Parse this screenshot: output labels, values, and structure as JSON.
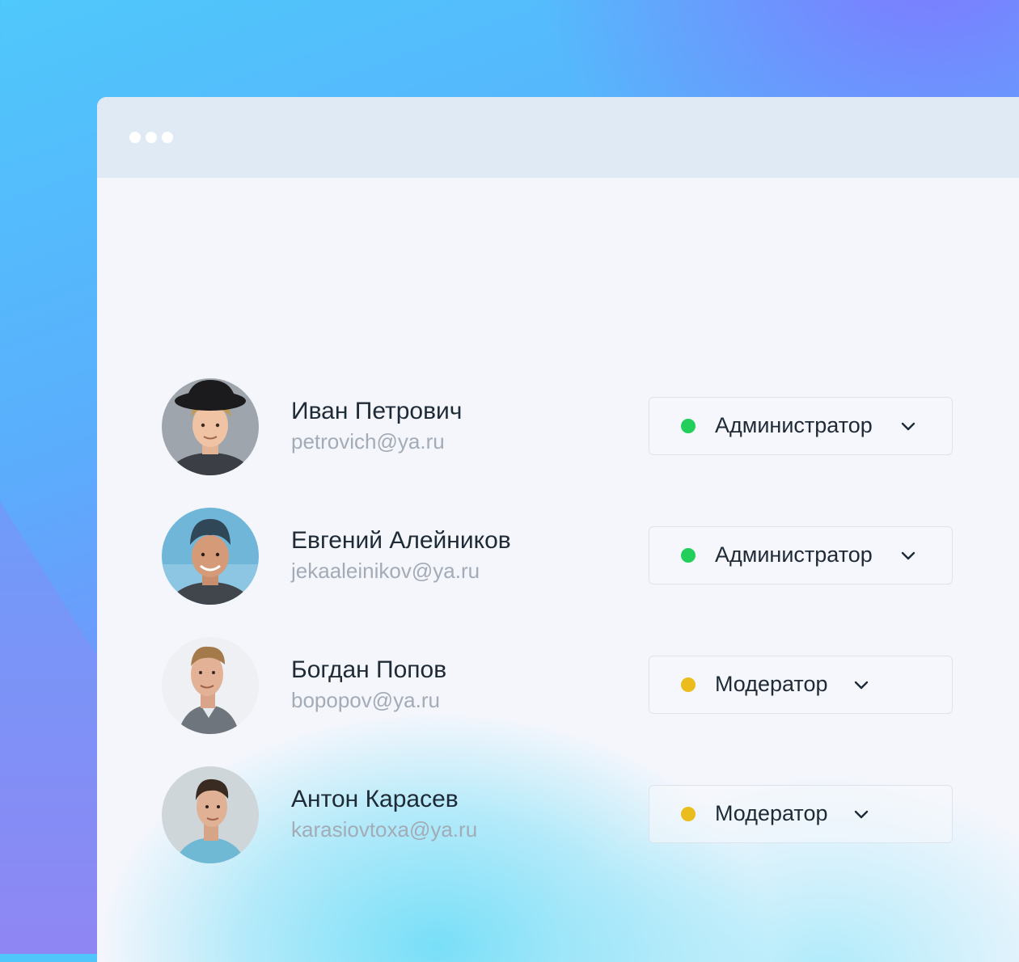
{
  "colors": {
    "admin_status": "#22cf5a",
    "moderator_status": "#eabd1c",
    "name_text": "#1e2a36",
    "email_text": "#a3abb6"
  },
  "users": [
    {
      "name": "Иван Петрович",
      "email": "petrovich@ya.ru",
      "role": "Администратор",
      "status": "green",
      "avatar_icon": "user-photo-avatar"
    },
    {
      "name": "Евгений Алейников",
      "email": "jekaaleinikov@ya.ru",
      "role": "Администратор",
      "status": "green",
      "avatar_icon": "user-photo-avatar"
    },
    {
      "name": "Богдан Попов",
      "email": "bopopov@ya.ru",
      "role": "Модератор",
      "status": "yellow",
      "avatar_icon": "user-photo-avatar"
    },
    {
      "name": "Антон Карасев",
      "email": "karasiovtoxa@ya.ru",
      "role": "Модератор",
      "status": "yellow",
      "avatar_icon": "user-photo-avatar"
    }
  ]
}
